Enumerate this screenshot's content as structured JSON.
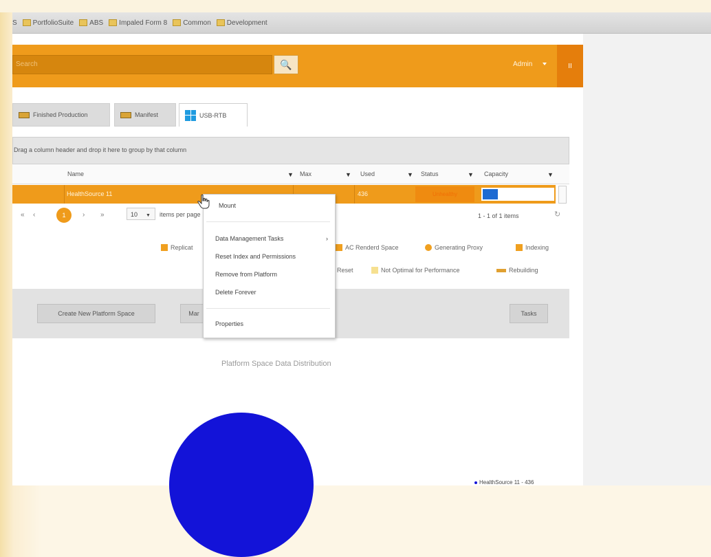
{
  "browser": {
    "bookmarks": [
      "PortfolioSuite",
      "ABS",
      "Impaled Form 8",
      "Common",
      "Development"
    ],
    "bookmark_prefix": "S"
  },
  "app": {
    "search_placeholder": "Search",
    "user": "Admin",
    "badge": "II"
  },
  "tabs": [
    {
      "label": "Finished Production"
    },
    {
      "label": "Manifest"
    },
    {
      "label": "USB-RTB"
    }
  ],
  "grid": {
    "group_hint": "Drag a column header and drop it here to group by that column",
    "columns": [
      {
        "label": "Name"
      },
      {
        "label": "Max"
      },
      {
        "label": "Used"
      },
      {
        "label": "Status"
      },
      {
        "label": "Capacity"
      }
    ],
    "rows": [
      {
        "name": "HealthSource 11",
        "max": "",
        "used": "436",
        "status": "Unhealthy",
        "capacity": 0.22
      }
    ],
    "pager": {
      "current_page": "1",
      "page_size": "10",
      "items_per_page_label": "items per page",
      "count_label": "1 - 1 of 1 items",
      "nav_first": "«",
      "nav_prev": "‹",
      "nav_next": "›",
      "nav_last": "»"
    }
  },
  "legend": [
    {
      "label": "Replicat",
      "color": "#f0a020"
    },
    {
      "label": "AC Renderd Space",
      "color": "#f0a020"
    },
    {
      "label": "Generating Proxy",
      "color": "#f0a020"
    },
    {
      "label": "Indexing",
      "color": "#f0a020"
    },
    {
      "label": "Reset",
      "color": ""
    },
    {
      "label": "Not Optimal for Performance",
      "color": "#f6e090"
    },
    {
      "label": "Rebuilding",
      "color": "#e0a030"
    }
  ],
  "actions": {
    "create": "Create New Platform Space",
    "manage": "Mar",
    "tasks": "Tasks"
  },
  "context_menu": {
    "items": [
      "Mount",
      "Data Management Tasks",
      "Reset Index and Permissions",
      "Remove from Platform",
      "Delete Forever",
      "Properties"
    ]
  },
  "chart_data": {
    "type": "pie",
    "title": "Platform Space Data Distribution",
    "slices": [
      {
        "label": "HealthSource 11 - 436",
        "value": 436,
        "color": "#1313d8"
      }
    ]
  },
  "colors": {
    "accent": "#ef9b1b",
    "accent_dark": "#d6860e",
    "pie": "#1313d8"
  }
}
